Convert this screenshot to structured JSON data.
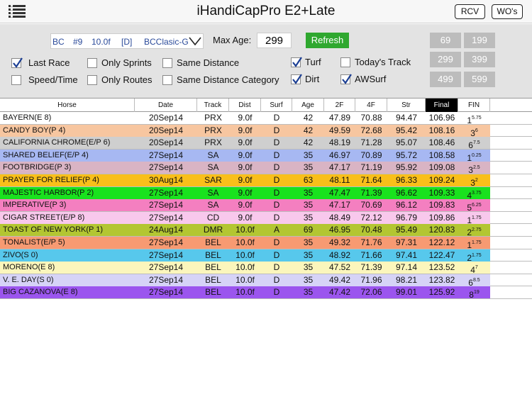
{
  "app": {
    "title": "iHandiCapPro E2+Late"
  },
  "toolbar": {
    "rcv_label": "RCV",
    "wos_label": "WO's"
  },
  "race": {
    "track": "BC",
    "number": "#9",
    "distance": "10.0f",
    "surface": "[D]",
    "name": "BCClasic-G"
  },
  "max_age": {
    "label": "Max Age:",
    "value": "299"
  },
  "refresh_label": "Refresh",
  "filters": {
    "last_race": {
      "label": "Last Race",
      "checked": true
    },
    "speed_time": {
      "label": "Speed/Time",
      "checked": false
    },
    "only_sprints": {
      "label": "Only Sprints",
      "checked": false
    },
    "only_routes": {
      "label": "Only Routes",
      "checked": false
    },
    "same_distance": {
      "label": "Same Distance",
      "checked": false
    },
    "same_distance_category": {
      "label": "Same Distance Category",
      "checked": false
    },
    "turf": {
      "label": "Turf",
      "checked": true
    },
    "dirt": {
      "label": "Dirt",
      "checked": true
    },
    "todays_track": {
      "label": "Today's Track",
      "checked": false
    },
    "awsurf": {
      "label": "AWSurf",
      "checked": true
    }
  },
  "age_buttons": [
    "69",
    "199",
    "299",
    "399",
    "499",
    "599"
  ],
  "columns": [
    "Horse",
    "Date",
    "Track",
    "Dist",
    "Surf",
    "Age",
    "2F",
    "4F",
    "Str",
    "Final",
    "FIN"
  ],
  "rows": [
    {
      "horse": "BAYERN(E   8)",
      "date": "20Sep14",
      "track": "PRX",
      "dist": "9.0f",
      "surf": "D",
      "age": "42",
      "f2": "47.89",
      "f4": "70.88",
      "str": "94.47",
      "final": "106.96",
      "fin": "1",
      "fin_sup": "5.75",
      "color": "#ffffff"
    },
    {
      "horse": "CANDY BOY(P   4)",
      "date": "20Sep14",
      "track": "PRX",
      "dist": "9.0f",
      "surf": "D",
      "age": "42",
      "f2": "49.59",
      "f4": "72.68",
      "str": "95.42",
      "final": "108.16",
      "fin": "3",
      "fin_sup": "6",
      "color": "#f7c6a0"
    },
    {
      "horse": "CALIFORNIA CHROME(E/P 6)",
      "date": "20Sep14",
      "track": "PRX",
      "dist": "9.0f",
      "surf": "D",
      "age": "42",
      "f2": "48.19",
      "f4": "71.28",
      "str": "95.07",
      "final": "108.46",
      "fin": "6",
      "fin_sup": "7.5",
      "color": "#cfcfcf"
    },
    {
      "horse": "SHARED BELIEF(E/P 4)",
      "date": "27Sep14",
      "track": "SA",
      "dist": "9.0f",
      "surf": "D",
      "age": "35",
      "f2": "46.97",
      "f4": "70.89",
      "str": "95.72",
      "final": "108.58",
      "fin": "1",
      "fin_sup": "0.25",
      "color": "#a7b8f2"
    },
    {
      "horse": "FOOTBRIDGE(P   3)",
      "date": "27Sep14",
      "track": "SA",
      "dist": "9.0f",
      "surf": "D",
      "age": "35",
      "f2": "47.17",
      "f4": "71.19",
      "str": "95.92",
      "final": "109.08",
      "fin": "3",
      "fin_sup": "2.5",
      "color": "#d9b4c4"
    },
    {
      "horse": "PRAYER FOR RELIEF(P   4)",
      "date": "30Aug14",
      "track": "SAR",
      "dist": "9.0f",
      "surf": "D",
      "age": "63",
      "f2": "48.11",
      "f4": "71.64",
      "str": "96.33",
      "final": "109.24",
      "fin": "3",
      "fin_sup": "2",
      "color": "#f9bf1a"
    },
    {
      "horse": "MAJESTIC HARBOR(P   2)",
      "date": "27Sep14",
      "track": "SA",
      "dist": "9.0f",
      "surf": "D",
      "age": "35",
      "f2": "47.47",
      "f4": "71.39",
      "str": "96.62",
      "final": "109.33",
      "fin": "4",
      "fin_sup": "3.75",
      "color": "#19e21e"
    },
    {
      "horse": "IMPERATIVE(P   3)",
      "date": "27Sep14",
      "track": "SA",
      "dist": "9.0f",
      "surf": "D",
      "age": "35",
      "f2": "47.17",
      "f4": "70.69",
      "str": "96.12",
      "final": "109.83",
      "fin": "5",
      "fin_sup": "6.25",
      "color": "#f47fc0"
    },
    {
      "horse": "CIGAR STREET(E/P 8)",
      "date": "27Sep14",
      "track": "CD",
      "dist": "9.0f",
      "surf": "D",
      "age": "35",
      "f2": "48.49",
      "f4": "72.12",
      "str": "96.79",
      "final": "109.86",
      "fin": "1",
      "fin_sup": "1.75",
      "color": "#f8c8ec"
    },
    {
      "horse": "TOAST OF NEW YORK(P   1)",
      "date": "24Aug14",
      "track": "DMR",
      "dist": "10.0f",
      "surf": "A",
      "age": "69",
      "f2": "46.95",
      "f4": "70.48",
      "str": "95.49",
      "final": "120.83",
      "fin": "2",
      "fin_sup": "2.75",
      "color": "#b3c632"
    },
    {
      "horse": "TONALIST(E/P 5)",
      "date": "27Sep14",
      "track": "BEL",
      "dist": "10.0f",
      "surf": "D",
      "age": "35",
      "f2": "49.32",
      "f4": "71.76",
      "str": "97.31",
      "final": "122.12",
      "fin": "1",
      "fin_sup": "1.75",
      "color": "#f79a72"
    },
    {
      "horse": "ZIVO(S   0)",
      "date": "27Sep14",
      "track": "BEL",
      "dist": "10.0f",
      "surf": "D",
      "age": "35",
      "f2": "48.92",
      "f4": "71.66",
      "str": "97.41",
      "final": "122.47",
      "fin": "2",
      "fin_sup": "1.75",
      "color": "#57c8ec"
    },
    {
      "horse": "MORENO(E   8)",
      "date": "27Sep14",
      "track": "BEL",
      "dist": "10.0f",
      "surf": "D",
      "age": "35",
      "f2": "47.52",
      "f4": "71.39",
      "str": "97.14",
      "final": "123.52",
      "fin": "4",
      "fin_sup": "7",
      "color": "#fbf6bc"
    },
    {
      "horse": "V. E. DAY(S   0)",
      "date": "27Sep14",
      "track": "BEL",
      "dist": "10.0f",
      "surf": "D",
      "age": "35",
      "f2": "49.42",
      "f4": "71.96",
      "str": "98.21",
      "final": "123.82",
      "fin": "6",
      "fin_sup": "8.5",
      "color": "#d6d3f7"
    },
    {
      "horse": "BIG CAZANOVA(E   8)",
      "date": "27Sep14",
      "track": "BEL",
      "dist": "10.0f",
      "surf": "D",
      "age": "35",
      "f2": "47.42",
      "f4": "72.06",
      "str": "99.01",
      "final": "125.92",
      "fin": "8",
      "fin_sup": "19",
      "color": "#9b55ee"
    }
  ]
}
